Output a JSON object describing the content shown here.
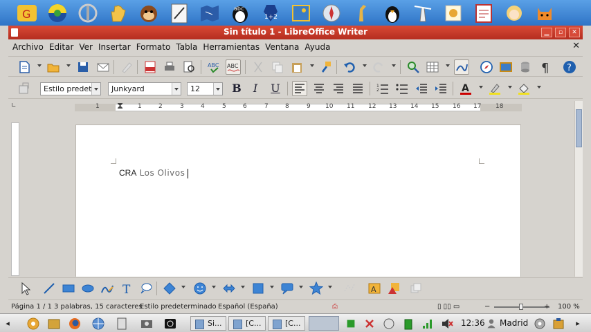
{
  "launcher": {
    "icons": [
      "gcompris-icon",
      "sun-clock-icon",
      "tux-paint-icon",
      "hand-icon",
      "monkey-icon",
      "drawing-icon",
      "map-icon",
      "tux-typing-icon",
      "math-icon",
      "image-icon",
      "compass-icon",
      "giraffe-icon",
      "penguin-icon",
      "lighthouse-icon",
      "stamp-icon",
      "writing-icon",
      "girl-icon",
      "cat-icon"
    ],
    "abc_label": "abc",
    "math_label": "1+2"
  },
  "window": {
    "title": "Sin título 1 - LibreOffice Writer"
  },
  "menubar": {
    "items": [
      "Archivo",
      "Editar",
      "Ver",
      "Insertar",
      "Formato",
      "Tabla",
      "Herramientas",
      "Ventana",
      "Ayuda"
    ]
  },
  "format_toolbar": {
    "style": "Estilo predete",
    "font": "Junkyard",
    "size": "12",
    "bold": "B",
    "italic": "I",
    "underline": "U"
  },
  "ruler": {
    "numbers": [
      "1",
      "1",
      "2",
      "3",
      "4",
      "5",
      "6",
      "7",
      "8",
      "9",
      "10",
      "11",
      "12",
      "13",
      "14",
      "15",
      "16",
      "17",
      "18"
    ]
  },
  "document": {
    "text_first": "CRA",
    "text_rest": " Los Olivos"
  },
  "statusbar": {
    "page": "Página 1 / 1",
    "words": "3 palabras, 15 caracteres",
    "style": "Estilo predeterminado",
    "language": "Español (España)",
    "zoom": "100 %",
    "zoom_minus": "−",
    "zoom_plus": "+"
  },
  "taskbar": {
    "tasks": [
      "Si...",
      "[C...",
      "[C..."
    ],
    "clock": "12:36",
    "location": "Madrid"
  },
  "colors": {
    "titlebar": "#c33a28",
    "launcher": "#3d84d4",
    "accent": "#2f74c6"
  }
}
